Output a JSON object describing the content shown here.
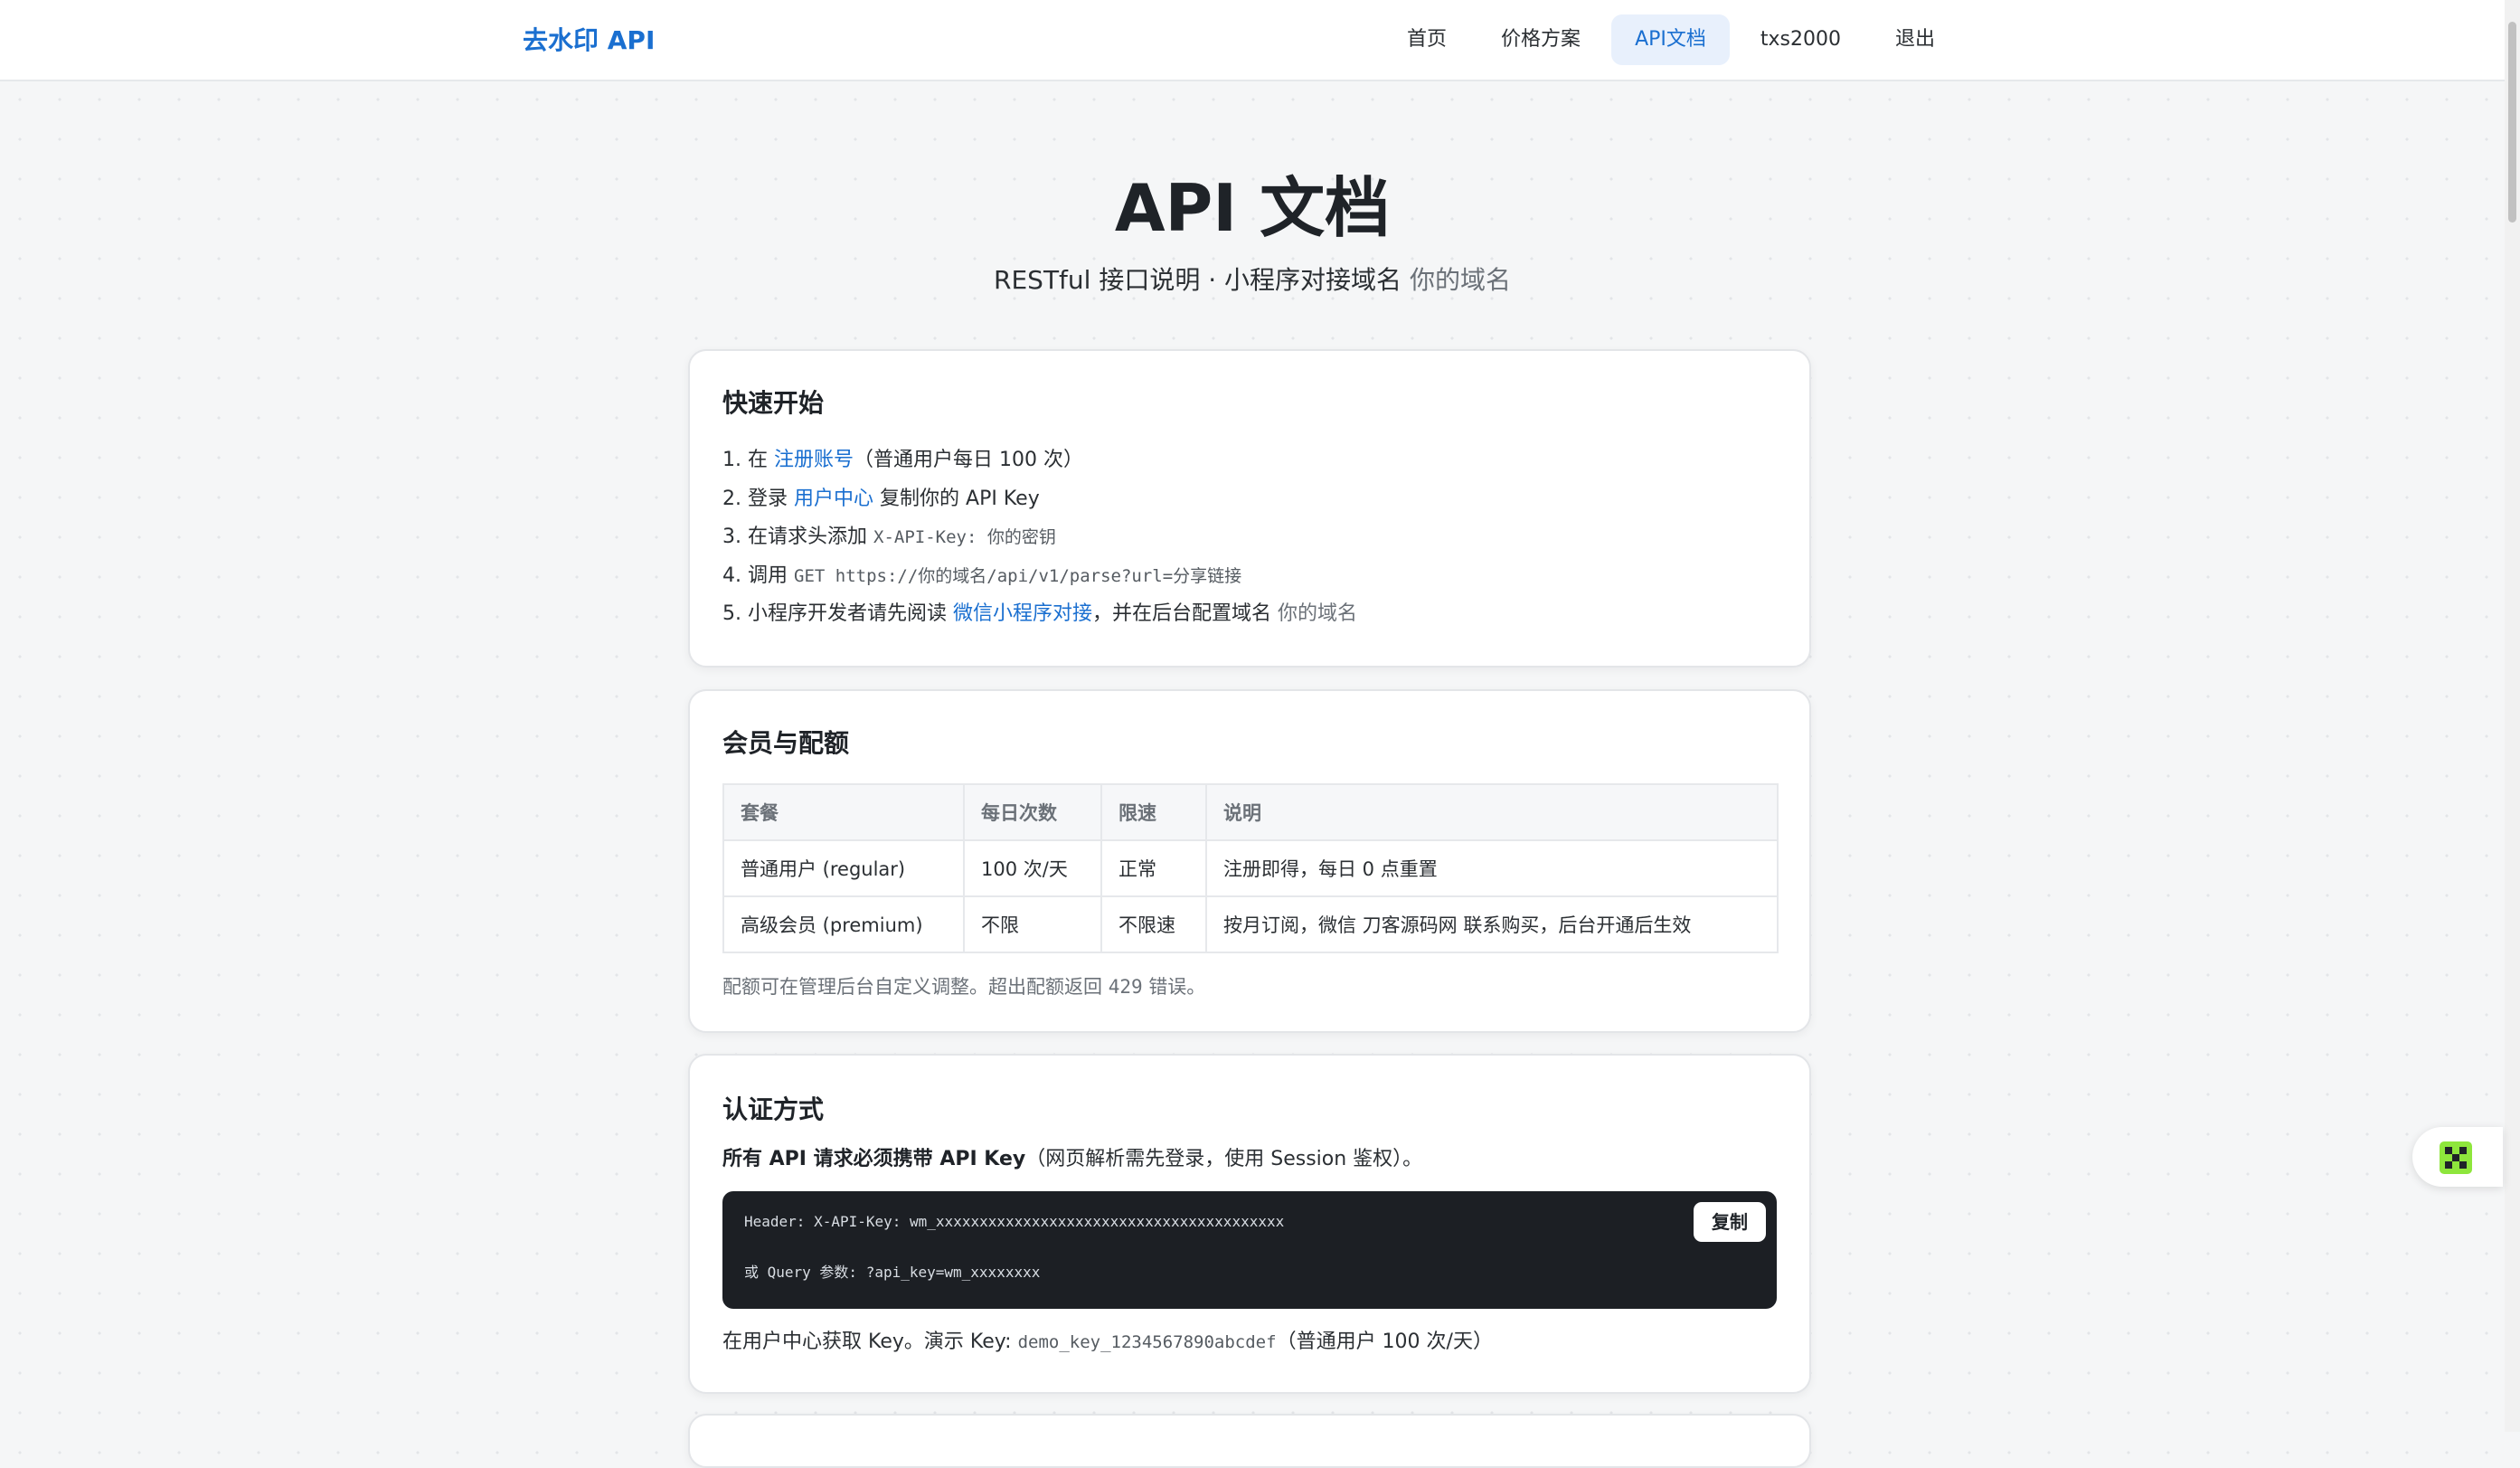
{
  "nav": {
    "brand": "去水印 API",
    "links": [
      {
        "label": "首页"
      },
      {
        "label": "价格方案"
      },
      {
        "label": "API文档"
      },
      {
        "label": "txs2000"
      },
      {
        "label": "退出"
      }
    ]
  },
  "page": {
    "title": "API 文档",
    "subtitle": "RESTful 接口说明 · 小程序对接域名",
    "subtitle_domain": "你的域名"
  },
  "quickstart": {
    "heading": "快速开始",
    "s1_num": "1.",
    "s1_pre": "在",
    "s1_link": "注册账号",
    "s1_post": "（普通用户每日 100 次）",
    "s2_num": "2.",
    "s2_pre": "登录",
    "s2_link": "用户中心",
    "s2_post": "复制你的 API Key",
    "s3_num": "3.",
    "s3_pre": "在请求头添加",
    "s3_code": "X-API-Key: 你的密钥",
    "s4_num": "4.",
    "s4_pre": "调用",
    "s4_code": "GET https://你的域名/api/v1/parse?url=分享链接",
    "s5_num": "5.",
    "s5_pre": "小程序开发者请先阅读",
    "s5_link": "微信小程序对接",
    "s5_mid": "，并在后台配置域名",
    "s5_domain": "你的域名"
  },
  "membership": {
    "heading": "会员与配额",
    "columns": [
      "套餐",
      "每日次数",
      "限速",
      "说明"
    ],
    "rows": [
      [
        "普通用户 (regular)",
        "100 次/天",
        "正常",
        "注册即得，每日 0 点重置"
      ],
      [
        "高级会员 (premium)",
        "不限",
        "不限速",
        "按月订阅，微信 刀客源码网 联系购买，后台开通后生效"
      ]
    ],
    "note_pre": "配额可在管理后台自定义调整。超出配额返回",
    "note_code": "429",
    "note_post": "错误。"
  },
  "auth": {
    "heading": "认证方式",
    "desc_bold": "所有 API 请求必须携带 API Key",
    "desc_rest": "（网页解析需先登录，使用 Session 鉴权）。",
    "code_line1": "Header: X-API-Key: wm_xxxxxxxxxxxxxxxxxxxxxxxxxxxxxxxxxxxxxxxx",
    "code_line2": "或 Query 参数: ?api_key=wm_xxxxxxxx",
    "copy_label": "复制",
    "key_pre": "在用户中心获取 Key。演示 Key:",
    "key_code": "demo_key_1234567890abcdef",
    "key_post": "（普通用户 100 次/天）"
  },
  "colors": {
    "accent": "#1a6fd0",
    "code_bg": "#1c1f24",
    "widget_green": "#8ee63c"
  },
  "icons": {
    "float_widget": "qr-grid-icon"
  }
}
